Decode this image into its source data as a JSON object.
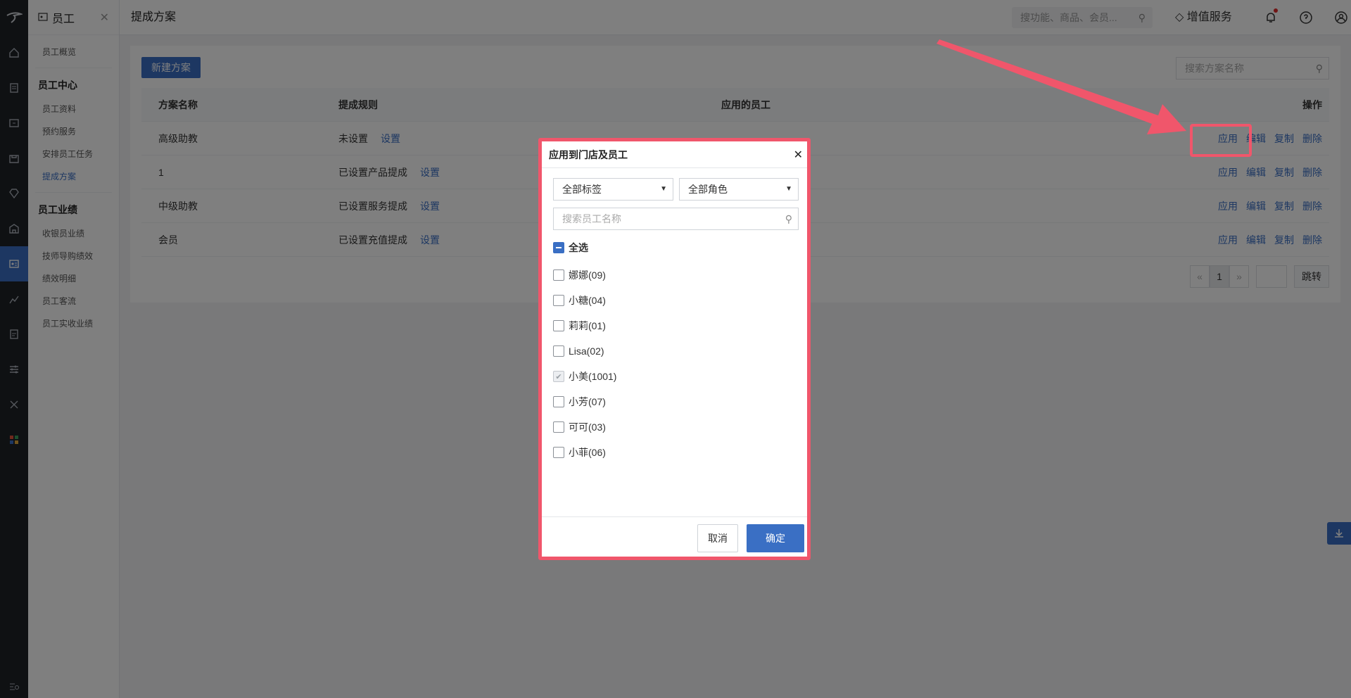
{
  "sidebar": {
    "module_title": "员工",
    "items": {
      "overview": "员工概览",
      "group_center": "员工中心",
      "profile": "员工资料",
      "booking": "预约服务",
      "tasks": "安排员工任务",
      "commission": "提成方案",
      "group_perf": "员工业绩",
      "cashier_perf": "收银员业绩",
      "tech_perf": "技师导购绩效",
      "perf_detail": "绩效明细",
      "traffic": "员工客流",
      "real_income": "员工实收业绩"
    }
  },
  "topbar": {
    "title": "提成方案",
    "search_placeholder": "搜功能、商品、会员...",
    "vip_label": "增值服务"
  },
  "page": {
    "new_button": "新建方案",
    "search_placeholder": "搜索方案名称",
    "columns": [
      "方案名称",
      "提成规则",
      "应用的员工",
      "操作"
    ],
    "set_label": "设置",
    "ops": [
      "应用",
      "编辑",
      "复制",
      "删除"
    ],
    "rows": [
      {
        "name": "高级助教",
        "rule": "未设置"
      },
      {
        "name": "1",
        "rule": "已设置产品提成"
      },
      {
        "name": "中级助教",
        "rule": "已设置服务提成"
      },
      {
        "name": "会员",
        "rule": "已设置充值提成"
      }
    ],
    "pager": {
      "prev": "«",
      "current": "1",
      "next": "»",
      "go": "跳转"
    }
  },
  "dialog": {
    "title": "应用到门店及员工",
    "tag_select": "全部标签",
    "role_select": "全部角色",
    "search_placeholder": "搜索员工名称",
    "select_all": "全选",
    "employees": [
      {
        "name": "娜娜(09)",
        "checked": false
      },
      {
        "name": "小糖(04)",
        "checked": false
      },
      {
        "name": "莉莉(01)",
        "checked": false
      },
      {
        "name": "Lisa(02)",
        "checked": false
      },
      {
        "name": "小美(1001)",
        "checked": true
      },
      {
        "name": "小芳(07)",
        "checked": false
      },
      {
        "name": "可可(03)",
        "checked": false
      },
      {
        "name": "小菲(06)",
        "checked": false
      }
    ],
    "cancel": "取消",
    "confirm": "确定"
  },
  "colors": {
    "accent": "#3a6fc4",
    "highlight": "#f0566b",
    "rail": "#1f2226"
  }
}
